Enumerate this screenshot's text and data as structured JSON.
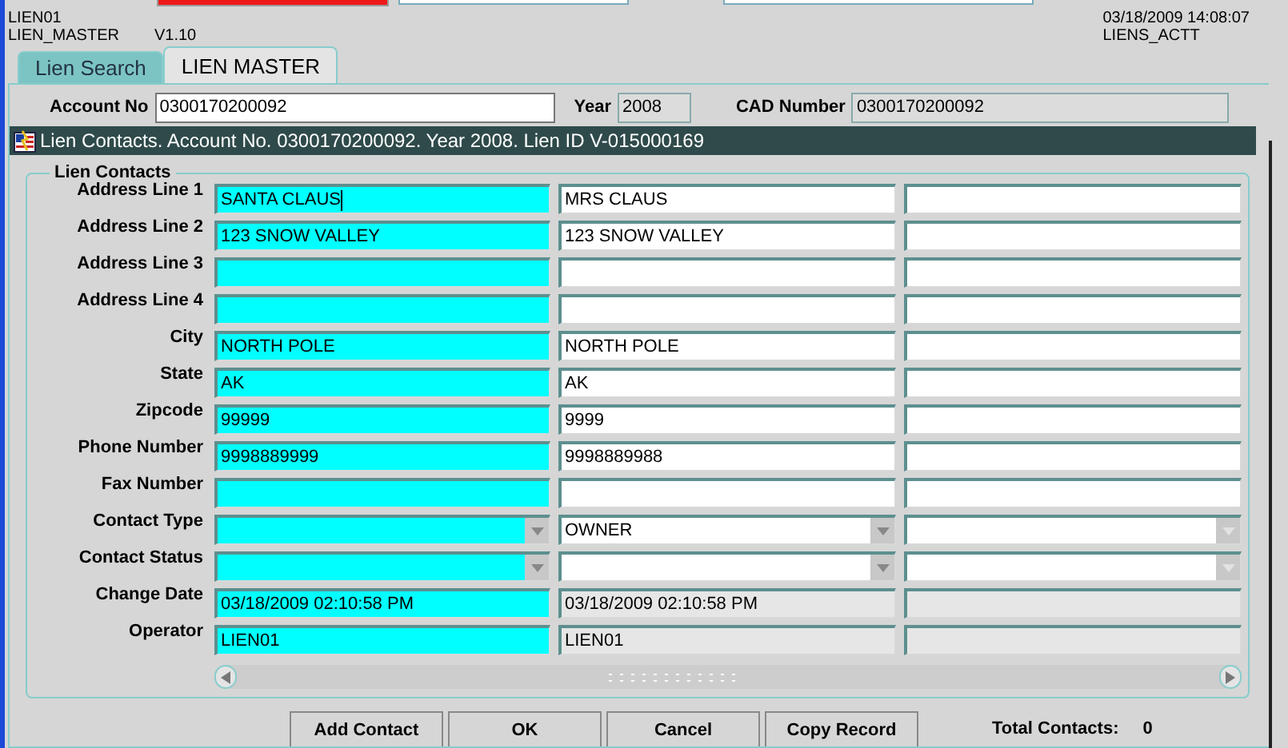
{
  "header": {
    "user": "LIEN01",
    "form": "LIEN_MASTER",
    "version": "V1.10",
    "datetime": "03/18/2009 14:08:07",
    "database": "LIENS_ACTT"
  },
  "tabs": [
    {
      "label": "Lien Search",
      "selected": false
    },
    {
      "label": "LIEN MASTER",
      "selected": true
    }
  ],
  "account": [
    {
      "label": "Account No",
      "value": "0300170200092",
      "kind": "editable"
    },
    {
      "label": "Year",
      "value": "2008",
      "kind": "readonly"
    },
    {
      "label": "CAD Number",
      "value": "0300170200092",
      "kind": "readonly"
    }
  ],
  "panel": {
    "title": "Lien Contacts. Account No. 0300170200092. Year 2008. Lien ID V-015000169",
    "section": "Lien Contacts"
  },
  "rows": [
    {
      "label": "Address Line 1",
      "kind": "text",
      "cells": [
        {
          "current": true,
          "focused": true,
          "value": "SANTA CLAUS"
        },
        {
          "current": false,
          "value": "MRS CLAUS"
        },
        {
          "current": false
        }
      ]
    },
    {
      "label": "Address Line 2",
      "kind": "text",
      "cells": [
        {
          "current": true,
          "value": "123 SNOW VALLEY"
        },
        {
          "current": false,
          "value": "123 SNOW VALLEY"
        },
        {
          "current": false
        }
      ]
    },
    {
      "label": "Address Line 3",
      "kind": "text",
      "cells": [
        {
          "current": true
        },
        {
          "current": false
        },
        {
          "current": false
        }
      ]
    },
    {
      "label": "Address Line 4",
      "kind": "text",
      "cells": [
        {
          "current": true
        },
        {
          "current": false
        },
        {
          "current": false
        }
      ]
    },
    {
      "label": "City",
      "kind": "text",
      "cells": [
        {
          "current": true,
          "value": "NORTH POLE"
        },
        {
          "current": false,
          "value": "NORTH POLE"
        },
        {
          "current": false
        }
      ]
    },
    {
      "label": "State",
      "kind": "text",
      "cells": [
        {
          "current": true,
          "value": "AK"
        },
        {
          "current": false,
          "value": "AK"
        },
        {
          "current": false
        }
      ]
    },
    {
      "label": "Zipcode",
      "kind": "text",
      "cells": [
        {
          "current": true,
          "value": "99999"
        },
        {
          "current": false,
          "value": "9999"
        },
        {
          "current": false
        }
      ]
    },
    {
      "label": "Phone Number",
      "kind": "text",
      "cells": [
        {
          "current": true,
          "value": "9998889999"
        },
        {
          "current": false,
          "value": "9998889988"
        },
        {
          "current": false
        }
      ]
    },
    {
      "label": "Fax Number",
      "kind": "text",
      "cells": [
        {
          "current": true
        },
        {
          "current": false
        },
        {
          "current": false
        }
      ]
    },
    {
      "label": "Contact Type",
      "kind": "select",
      "cells": [
        {
          "current": true
        },
        {
          "current": false,
          "value": "OWNER"
        },
        {
          "current": false
        }
      ]
    },
    {
      "label": "Contact Status",
      "kind": "select",
      "cells": [
        {
          "current": true
        },
        {
          "current": false
        },
        {
          "current": false
        }
      ]
    },
    {
      "label": "Change Date",
      "kind": "readonly",
      "cells": [
        {
          "current": true,
          "value": "03/18/2009 02:10:58 PM"
        },
        {
          "current": false,
          "value": "03/18/2009 02:10:58 PM"
        },
        {
          "current": false
        }
      ]
    },
    {
      "label": "Operator",
      "kind": "readonly",
      "cells": [
        {
          "current": true,
          "value": "LIEN01"
        },
        {
          "current": false,
          "value": "LIEN01"
        },
        {
          "current": false
        }
      ]
    }
  ],
  "buttons": [
    "Add Contact",
    "OK",
    "Cancel",
    "Copy Record"
  ],
  "total": {
    "label": "Total Contacts:",
    "value": "0"
  }
}
